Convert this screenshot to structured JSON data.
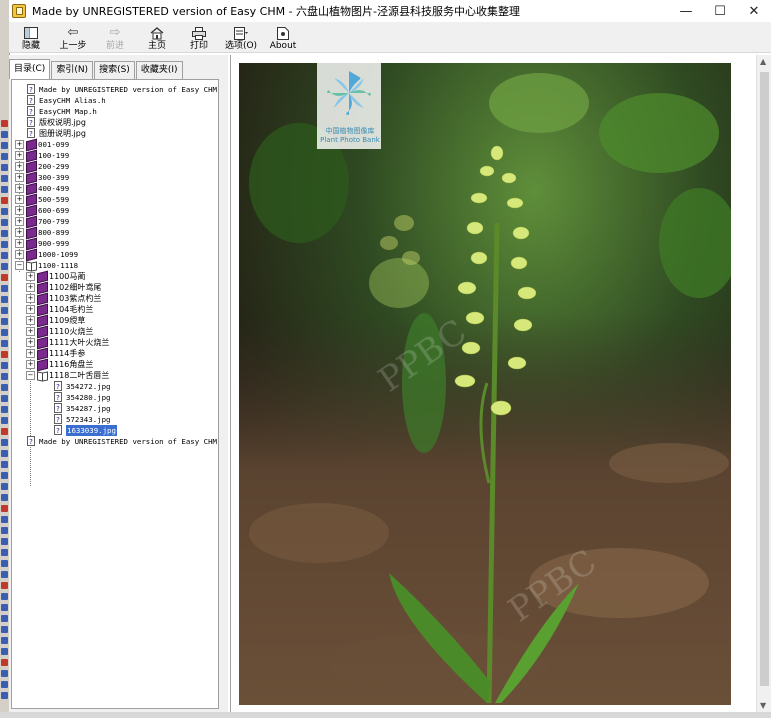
{
  "window": {
    "title": "Made by UNREGISTERED version of Easy CHM - 六盘山植物图片-泾源县科技服务中心收集整理",
    "minimize": "—",
    "maximize": "☐",
    "close": "✕"
  },
  "toolbar": {
    "hide": "隐藏",
    "back": "上一步",
    "forward": "前进",
    "home": "主页",
    "print": "打印",
    "options": "选项(O)",
    "about": "About"
  },
  "tabs": {
    "contents": "目录(C)",
    "index": "索引(N)",
    "search": "搜索(S)",
    "favorites": "收藏夹(I)"
  },
  "tree": {
    "rows": [
      {
        "label": "Made by UNREGISTERED version of Easy CHM -"
      },
      {
        "label": "EasyCHM Alias.h"
      },
      {
        "label": "EasyCHM Map.h"
      },
      {
        "label": "版权说明.jpg"
      },
      {
        "label": "图册说明.jpg"
      },
      {
        "label": "001-099"
      },
      {
        "label": "100-199"
      },
      {
        "label": "200-299"
      },
      {
        "label": "300-399"
      },
      {
        "label": "400-499"
      },
      {
        "label": "500-599"
      },
      {
        "label": "600-699"
      },
      {
        "label": "700-799"
      },
      {
        "label": "800-899"
      },
      {
        "label": "900-999"
      },
      {
        "label": "1000-1099"
      },
      {
        "label": "1100-1118"
      },
      {
        "label": "1100马蔺"
      },
      {
        "label": "1102细叶鸢尾"
      },
      {
        "label": "1103紫点杓兰"
      },
      {
        "label": "1104毛杓兰"
      },
      {
        "label": "1109绶草"
      },
      {
        "label": "1110火烧兰"
      },
      {
        "label": "1111大叶火烧兰"
      },
      {
        "label": "1114手参"
      },
      {
        "label": "1116角盘兰"
      },
      {
        "label": "1118二叶舌唇兰"
      },
      {
        "label": "354272.jpg"
      },
      {
        "label": "354280.jpg"
      },
      {
        "label": "354287.jpg"
      },
      {
        "label": "572343.jpg"
      },
      {
        "label": "1633039.jpg"
      },
      {
        "label": "Made by UNREGISTERED version of Easy CHM -"
      }
    ]
  },
  "watermark": {
    "logo_cn": "中国植物图像库",
    "logo_en": "Plant Photo Bank"
  },
  "colors": {
    "selection": "#3a6fd1",
    "book": "#7a2a8c"
  }
}
